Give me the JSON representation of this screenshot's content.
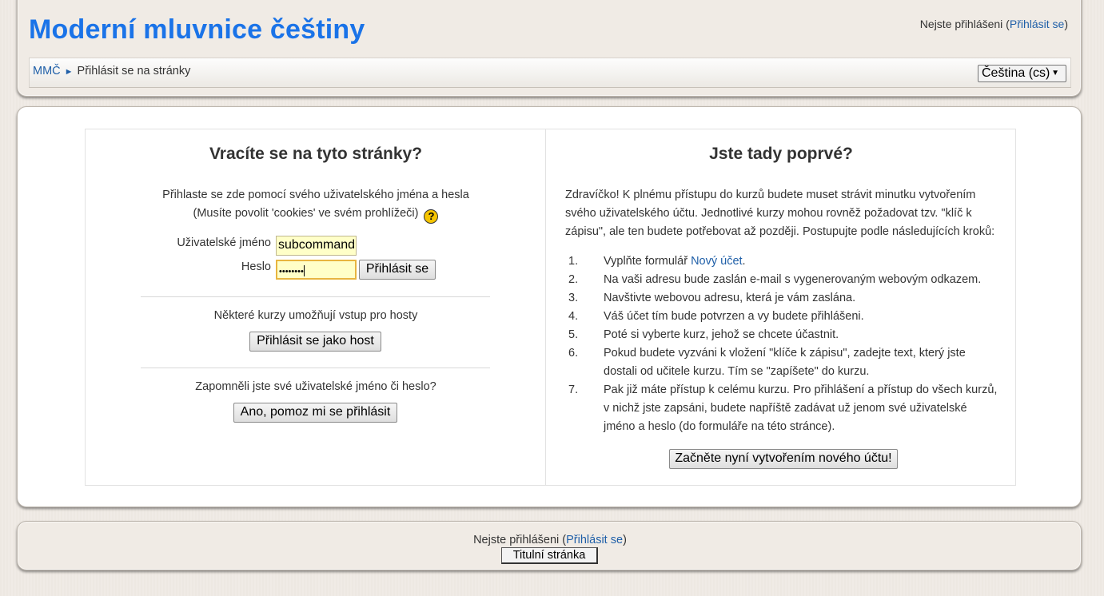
{
  "header": {
    "site_title": "Moderní mluvnice češtiny",
    "login_status_prefix": "Nejste přihlášeni (",
    "login_link": "Přihlásit se",
    "login_status_suffix": ")"
  },
  "navbar": {
    "breadcrumb_home": "MMČ",
    "breadcrumb_separator": "►",
    "breadcrumb_current": "Přihlásit se na stránky",
    "language_selected": "Čeština (cs)"
  },
  "login": {
    "title": "Vracíte se na tyto stránky?",
    "desc_line1": "Přihlaste se zde pomocí svého uživatelského jména a hesla",
    "desc_line2": "(Musíte povolit 'cookies' ve svém prohlížeči)",
    "username_label": "Uživatelské jméno",
    "username_value": "subcommand",
    "password_label": "Heslo",
    "password_value": "••••••••",
    "login_button": "Přihlásit se",
    "guest_text": "Některé kurzy umožňují vstup pro hosty",
    "guest_button": "Přihlásit se jako host",
    "forgot_text": "Zapomněli jste své uživatelské jméno či heslo?",
    "forgot_button": "Ano, pomoz mi se přihlásit"
  },
  "signup": {
    "title": "Jste tady poprvé?",
    "intro": "Zdravíčko! K plnému přístupu do kurzů budete muset strávit minutku vytvořením svého uživatelského účtu. Jednotlivé kurzy mohou rovněž požadovat tzv. \"klíč k zápisu\", ale ten budete potřebovat až později. Postupujte podle následujících kroků:",
    "step1_prefix": "Vyplňte formulář ",
    "step1_link": "Nový účet",
    "step1_suffix": ".",
    "steps": [
      {
        "num": "1.",
        "text": ""
      },
      {
        "num": "2.",
        "text": "Na vaši adresu bude zaslán e-mail s vygenerovaným webovým odkazem."
      },
      {
        "num": "3.",
        "text": "Navštivte webovou adresu, která je vám zaslána."
      },
      {
        "num": "4.",
        "text": "Váš účet tím bude potvrzen a vy budete přihlášeni."
      },
      {
        "num": "5.",
        "text": "Poté si vyberte kurz, jehož se chcete účastnit."
      },
      {
        "num": "6.",
        "text": "Pokud budete vyzváni k vložení \"klíče k zápisu\", zadejte text, který jste dostali od učitele kurzu. Tím se \"zapíšete\" do kurzu."
      },
      {
        "num": "7.",
        "text": "Pak již máte přístup k celému kurzu. Pro přihlášení a přístup do všech kurzů, v nichž jste zapsáni, budete napříště zadávat už jenom své uživatelské jméno a heslo (do formuláře na této stránce)."
      }
    ],
    "signup_button": "Začněte nyní vytvořením nového účtu!"
  },
  "footer": {
    "login_status_prefix": "Nejste přihlášeni (",
    "login_link": "Přihlásit se",
    "login_status_suffix": ")",
    "home_button": "Titulní stránka"
  },
  "colors": {
    "title_blue": "#1a73e8",
    "link_blue": "#1f5fa8",
    "background": "#f0ebe5",
    "input_highlight": "#ffffc8"
  }
}
